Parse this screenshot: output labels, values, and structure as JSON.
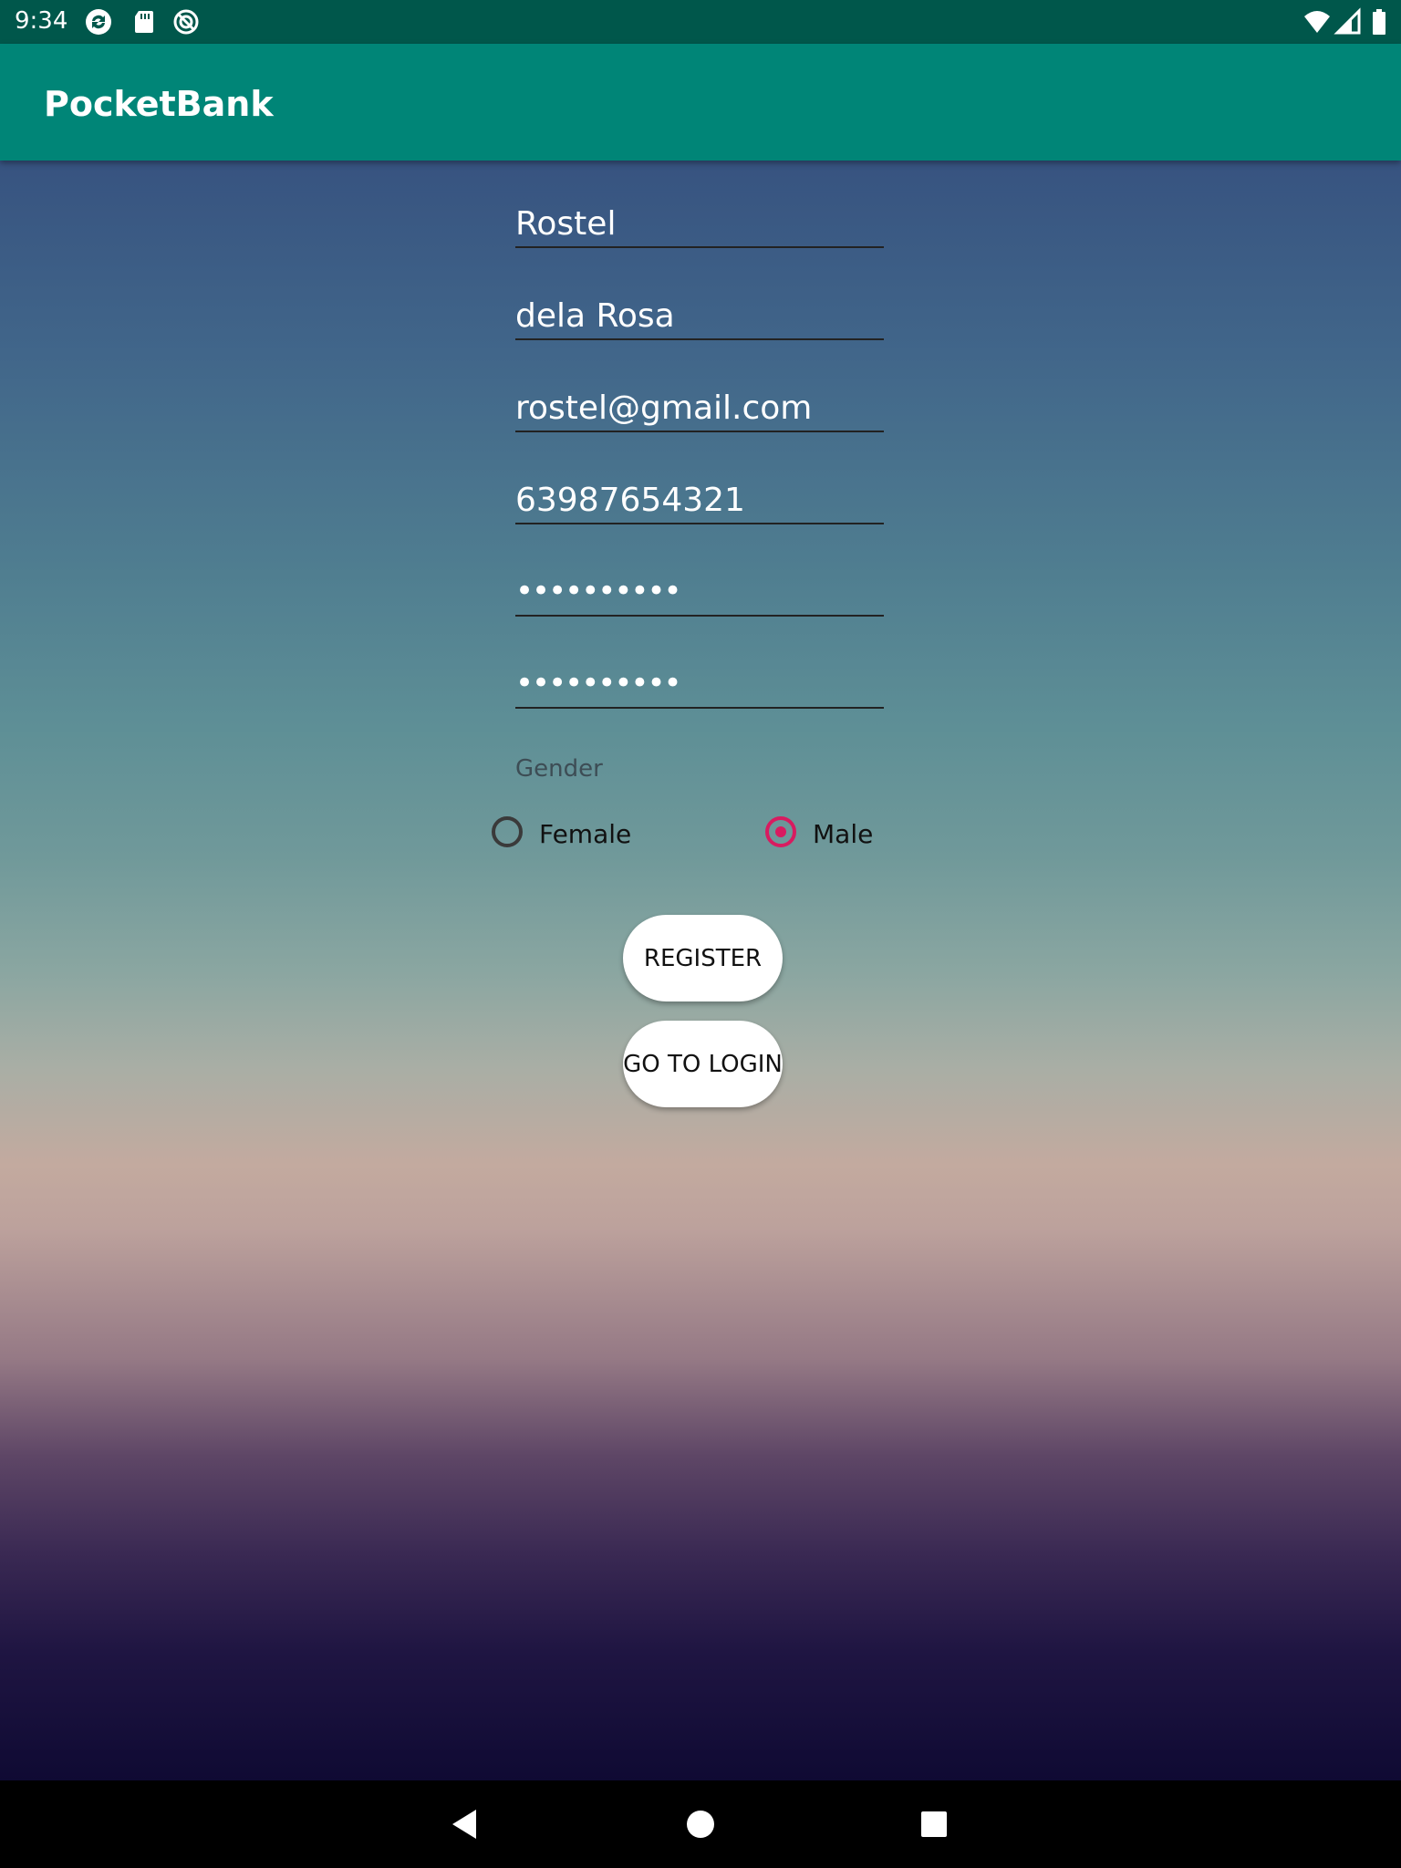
{
  "status_bar": {
    "time": "9:34",
    "left_icons": [
      "sync-icon",
      "sd-card-icon",
      "no-disturb-icon"
    ],
    "right_icons": [
      "wifi-icon",
      "signal-icon",
      "battery-icon"
    ]
  },
  "app_bar": {
    "title": "PocketBank",
    "color": "#008577"
  },
  "form": {
    "first_name": "Rostel",
    "last_name": "dela Rosa",
    "email": "rostel@gmail.com",
    "phone": "63987654321",
    "password": "••••••••••",
    "confirm_password": "••••••••••",
    "gender_label": "Gender",
    "gender_options": [
      {
        "label": "Female",
        "selected": false
      },
      {
        "label": "Male",
        "selected": true
      }
    ],
    "accent_color": "#d81b60"
  },
  "buttons": {
    "register": "REGISTER",
    "go_to_login": "GO TO LOGIN"
  },
  "nav_bar": {
    "icons": [
      "back-icon",
      "home-icon",
      "recents-icon"
    ]
  }
}
